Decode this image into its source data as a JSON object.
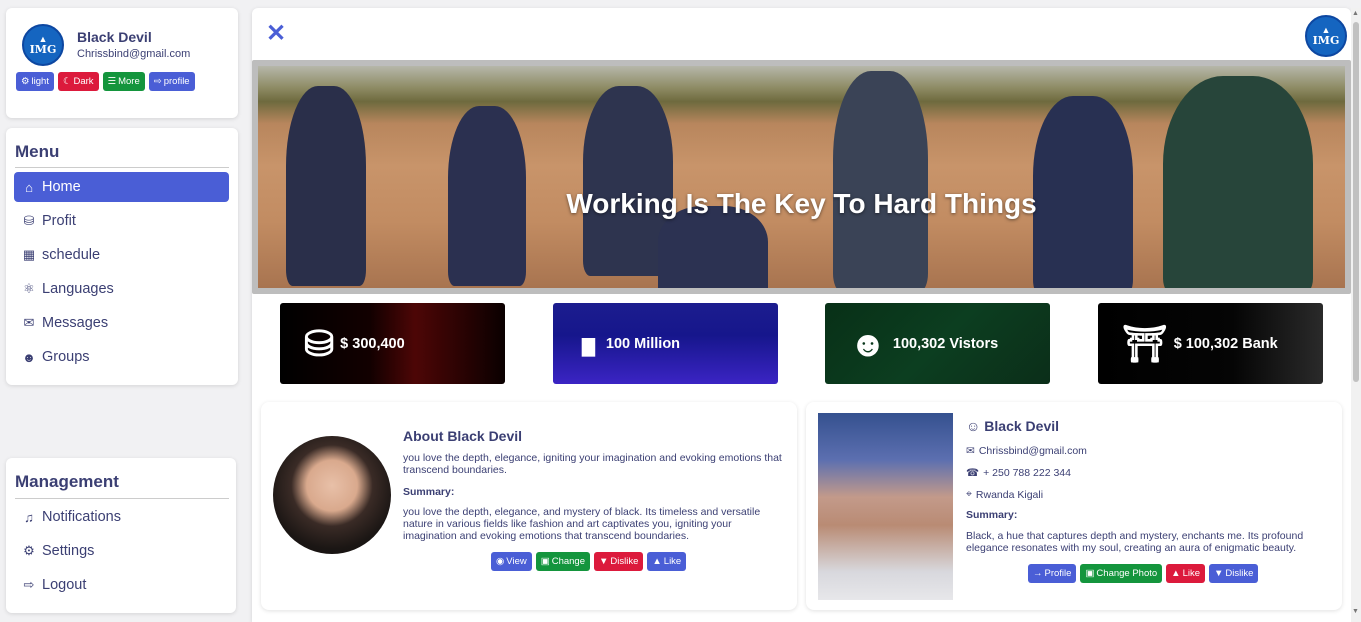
{
  "profile": {
    "logo_text": "IMG",
    "name": "Black Devil",
    "email": "Chrissbind@gmail.com",
    "buttons": [
      {
        "label": "light",
        "icon": "gear-icon"
      },
      {
        "label": "Dark",
        "icon": "moon-icon"
      },
      {
        "label": "More",
        "icon": "menu-icon"
      },
      {
        "label": "profile",
        "icon": "sign-out-icon"
      }
    ]
  },
  "menu": {
    "title": "Menu",
    "items": [
      {
        "label": "Home",
        "icon": "home-icon"
      },
      {
        "label": "Profit",
        "icon": "coins-icon"
      },
      {
        "label": "schedule",
        "icon": "calendar-icon"
      },
      {
        "label": "Languages",
        "icon": "globe-icon"
      },
      {
        "label": "Messages",
        "icon": "comments-icon"
      },
      {
        "label": "Groups",
        "icon": "users-icon"
      }
    ]
  },
  "management": {
    "title": "Management",
    "items": [
      {
        "label": "Notifications",
        "icon": "bell-icon"
      },
      {
        "label": "Settings",
        "icon": "gear-icon"
      },
      {
        "label": "Logout",
        "icon": "sign-out-icon"
      }
    ]
  },
  "main": {
    "logo_text": "IMG",
    "hero_text": "Working Is The Key To Hard Things",
    "stats": [
      {
        "label": "$ 300,400",
        "icon": "coins-icon"
      },
      {
        "label": "100 Million",
        "icon": "chart-icon"
      },
      {
        "label": "100,302 Vistors",
        "icon": "users-icon"
      },
      {
        "label": "$ 100,302 Bank",
        "icon": "bank-icon"
      }
    ]
  },
  "about": {
    "title": "About Black Devil",
    "description": "you love the depth, elegance, igniting your imagination and evoking emotions that transcend boundaries.",
    "summary_label": "Summary:",
    "summary": "you love the depth, elegance, and mystery of black. Its timeless and versatile nature in various fields like fashion and art captivates you, igniting your imagination and evoking emotions that transcend boundaries.",
    "buttons": [
      {
        "label": "View",
        "icon": "eye-icon"
      },
      {
        "label": "Change",
        "icon": "camera-icon"
      },
      {
        "label": "Dislike",
        "icon": "thumbs-down-icon"
      },
      {
        "label": "Like",
        "icon": "thumbs-up-icon"
      }
    ]
  },
  "profile_card": {
    "name": "Black Devil",
    "email": "Chrissbind@gmail.com",
    "phone": "+ 250 788 222 344",
    "location": "Rwanda Kigali",
    "summary_label": "Summary:",
    "summary": "Black, a hue that captures depth and mystery, enchants me. Its profound elegance resonates with my soul, creating an aura of enigmatic beauty.",
    "buttons": [
      {
        "label": "Profile",
        "icon": "arrow-right-icon"
      },
      {
        "label": "Change Photo",
        "icon": "camera-icon"
      },
      {
        "label": "Like",
        "icon": "thumbs-up-icon"
      },
      {
        "label": "Dislike",
        "icon": "thumbs-down-icon"
      }
    ]
  },
  "colors": {
    "primary": "#4a5ed6",
    "danger": "#dc1a3c",
    "success": "#14953d",
    "text": "#3b3f73"
  }
}
